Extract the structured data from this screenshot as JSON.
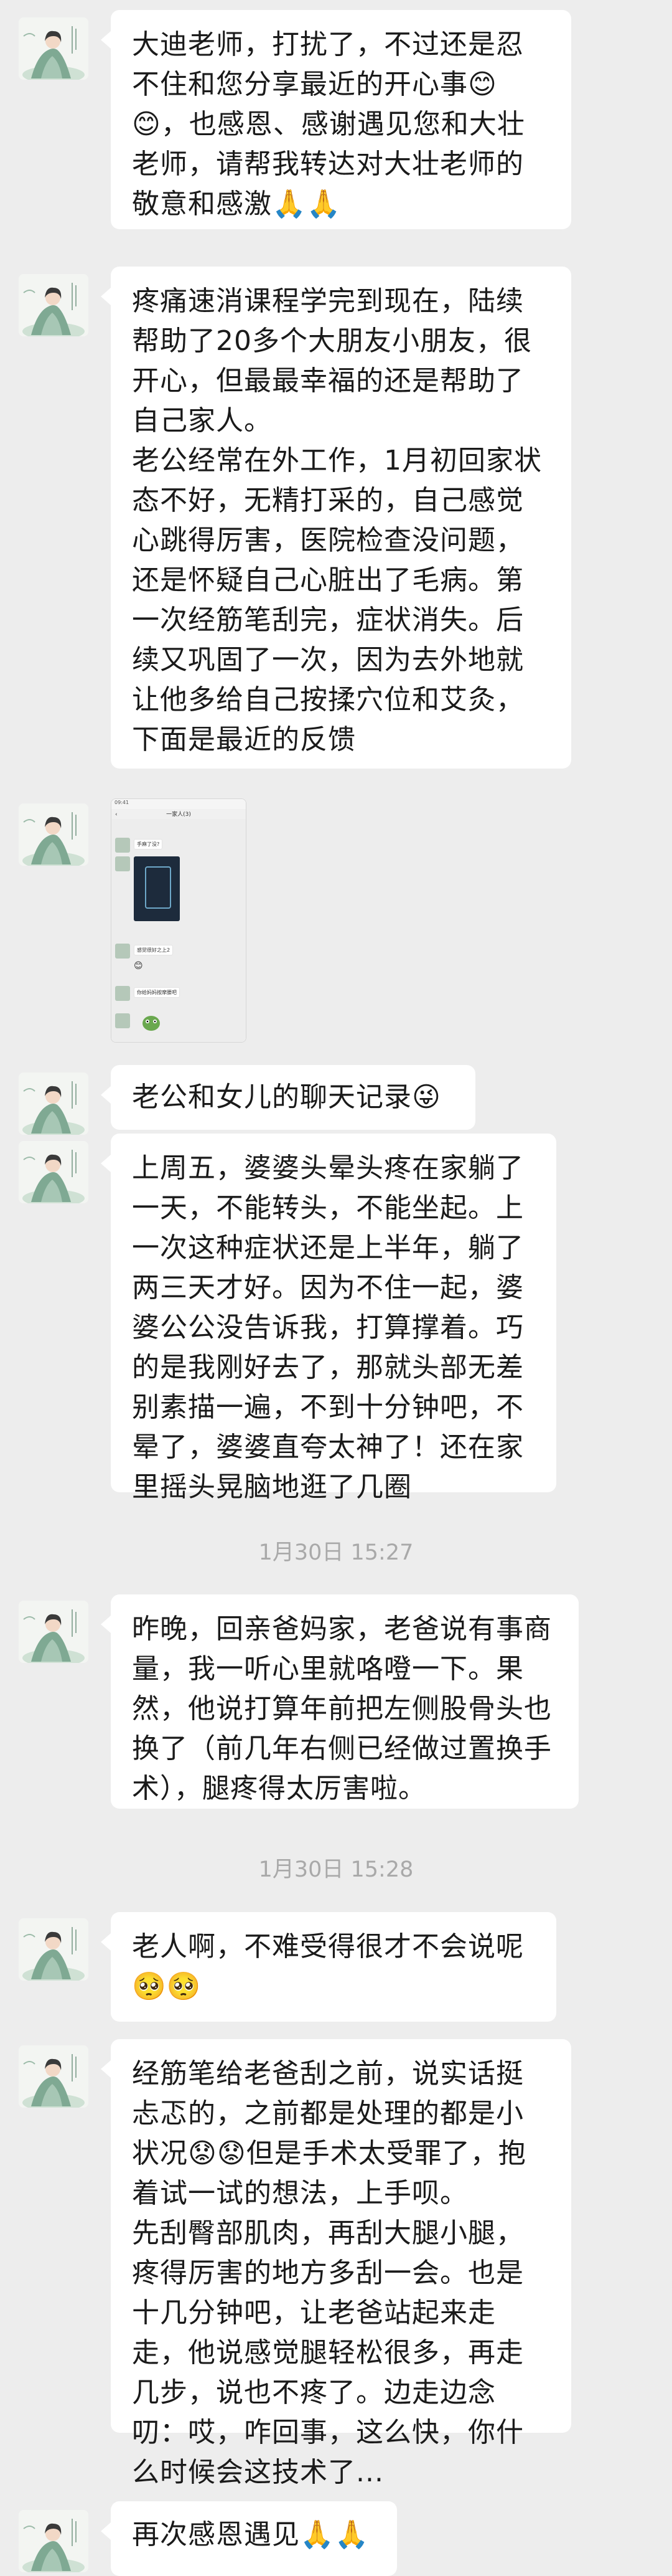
{
  "messages": [
    {
      "text": "大迪老师，打扰了，不过还是忍不住和您分享最近的开心事😊😊，也感恩、感谢遇见您和大壮老师，请帮我转达对大壮老师的敬意和感激🙏🙏"
    },
    {
      "text": "疼痛速消课程学完到现在，陆续帮助了20多个大朋友小朋友，很开心，但最最幸福的还是帮助了自己家人。\n老公经常在外工作，1月初回家状态不好，无精打采的，自己感觉心跳得厉害，医院检查没问题，还是怀疑自己心脏出了毛病。第一次经筋笔刮完，症状消失。后续又巩固了一次，因为去外地就让他多给自己按揉穴位和艾灸，下面是最近的反馈"
    },
    {
      "text": "老公和女儿的聊天记录😜"
    },
    {
      "text": "上周五，婆婆头晕头疼在家躺了一天，不能转头，不能坐起。上一次这种症状还是上半年，躺了两三天才好。因为不住一起，婆婆公公没告诉我，打算撑着。巧的是我刚好去了，那就头部无差别素描一遍，不到十分钟吧，不晕了，婆婆直夸太神了！还在家里摇头晃脑地逛了几圈"
    },
    {
      "text": "昨晚，回亲爸妈家，老爸说有事商量，我一听心里就咯噔一下。果然，他说打算年前把左侧股骨头也换了（前几年右侧已经做过置换手术），腿疼得太厉害啦。"
    },
    {
      "text": "老人啊，不难受得很才不会说呢🥺🥺"
    },
    {
      "text": "经筋笔给老爸刮之前，说实话挺忐忑的，之前都是处理的都是小状况😟😟但是手术太受罪了，抱着试一试的想法，上手呗。\n先刮臀部肌肉，再刮大腿小腿，疼得厉害的地方多刮一会。也是十几分钟吧，让老爸站起来走走，他说感觉腿轻松很多，再走几步，说也不疼了。边走边念叨：哎，咋回事，这么快，你什么时候会这技术了..."
    },
    {
      "text": "再次感恩遇见🙏🙏"
    }
  ],
  "timestamps": [
    "1月30日 15:27",
    "1月30日 15:28"
  ],
  "screenshot": {
    "status": "09:41",
    "title": "一家人(3)",
    "msg1": "手麻了没?",
    "msg2": "感觉很好之上2",
    "msg3": "你给妈妈按摩腰吧"
  },
  "colors": {
    "background": "#ededed",
    "bubble": "#ffffff",
    "timestamp": "#a9a9a9"
  }
}
